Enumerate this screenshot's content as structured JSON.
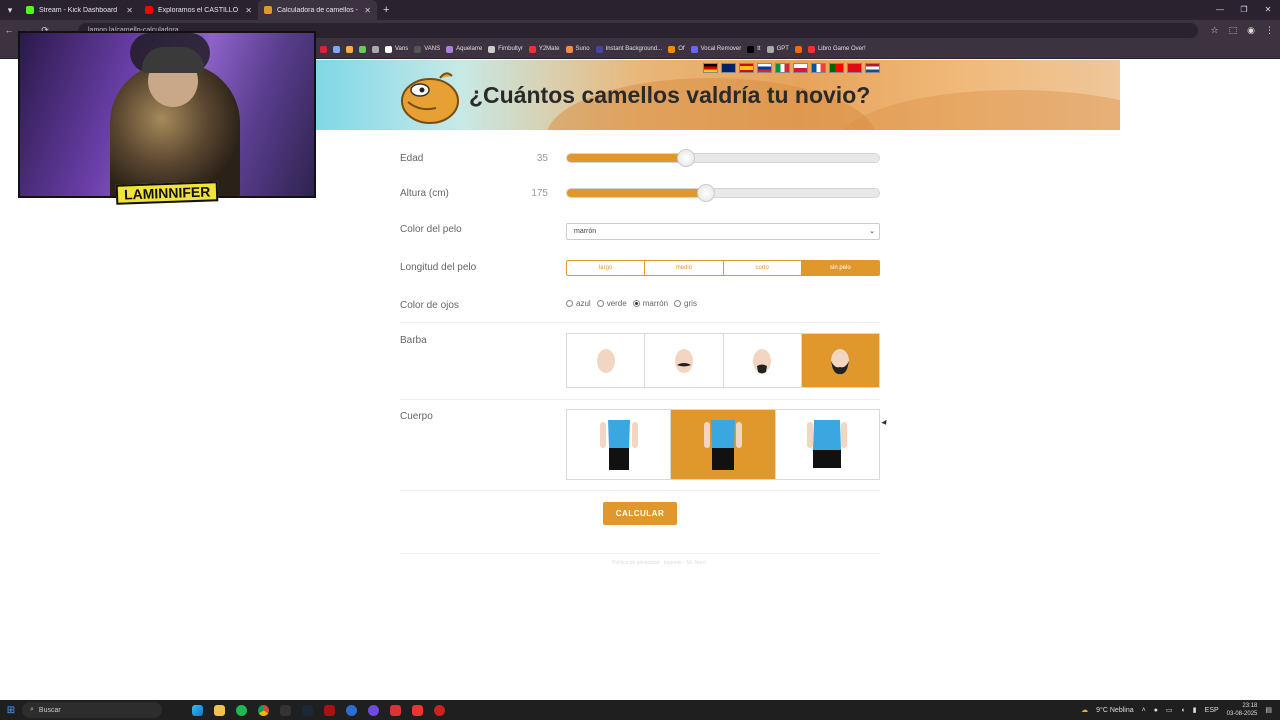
{
  "browser": {
    "tabs": [
      {
        "title": "Stream - Kick Dashboard",
        "fav_color": "#53fc18"
      },
      {
        "title": "Exploramos el CASTILLO BUTR",
        "fav_color": "#ff0000"
      },
      {
        "title": "Calculadora de camellos - la ca",
        "fav_color": "#e0982c"
      }
    ],
    "url": "lamon.la/camello-calculadora",
    "bookmarks": [
      "Vans",
      "VANS",
      "Aquelarre",
      "Fimbultyr",
      "Y2Mate",
      "Suno",
      "Instant Background...",
      "Of",
      "Vocal Remover",
      "tt",
      "GPT",
      "Libro Game Over!"
    ]
  },
  "page": {
    "title": "¿Cuántos camellos valdría tu novio?",
    "fields": {
      "age": {
        "label": "Edad",
        "value": "35",
        "fraction": 0.38
      },
      "height": {
        "label": "Altura (cm)",
        "value": "175",
        "fraction": 0.445
      },
      "hair_color": {
        "label": "Color del pelo",
        "selected": "marrón"
      },
      "hair_length": {
        "label": "Longitud del pelo",
        "options": [
          "largo",
          "medio",
          "corto",
          "sin pelo"
        ],
        "selected_index": 3
      },
      "eye_color": {
        "label": "Color de ojos",
        "options": [
          "azul",
          "verde",
          "marrón",
          "gris"
        ],
        "selected_index": 2
      },
      "beard": {
        "label": "Barba",
        "selected_index": 3
      },
      "body": {
        "label": "Cuerpo",
        "selected_index": 1
      }
    },
    "submit_label": "CALCULAR",
    "footer": "Política de privacidad · Imprimir · Mr. Nerd"
  },
  "overlay": {
    "streamer_name": "LAMINNIFER"
  },
  "taskbar": {
    "search_placeholder": "Buscar",
    "weather": "9°C  Neblina",
    "lang": "ESP",
    "time": "23:18",
    "date": "03-08-2025"
  }
}
